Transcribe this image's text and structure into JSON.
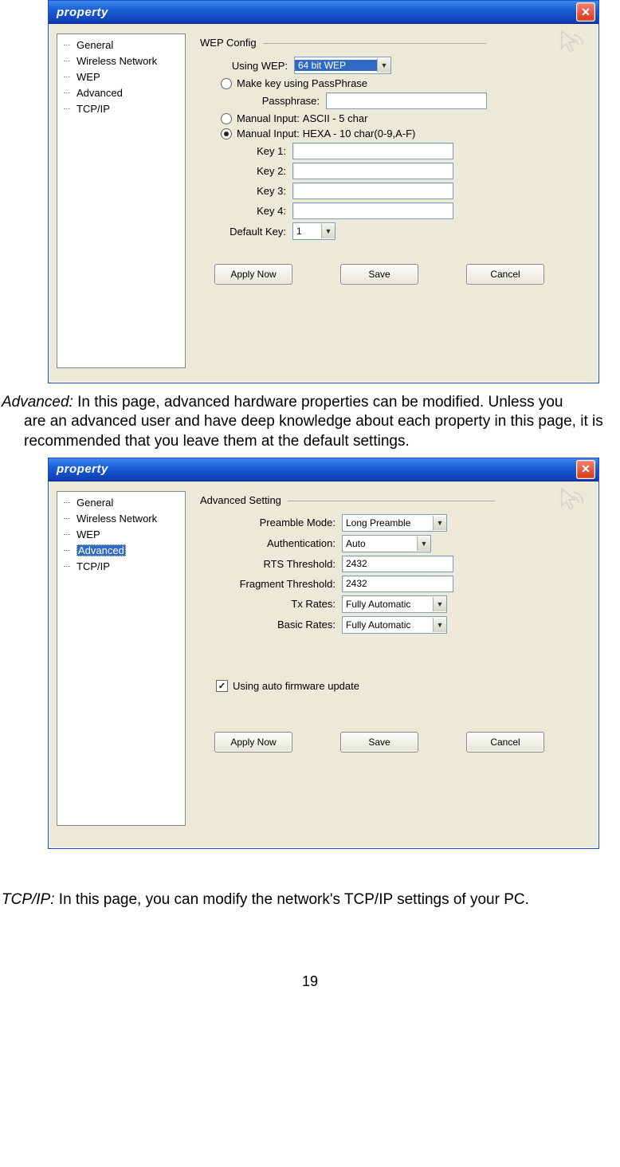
{
  "win1": {
    "title": "property",
    "tree": [
      "General",
      "Wireless Network",
      "WEP",
      "Advanced",
      "TCP/IP"
    ],
    "selected_index": -1,
    "section": "WEP Config",
    "using_wep_label": "Using WEP:",
    "using_wep_value": "64 bit WEP",
    "radio_passphrase": "Make key using PassPhrase",
    "passphrase_label": "Passphrase:",
    "radio_ascii": "Manual Input:",
    "ascii_suffix": "ASCII - 5 char",
    "radio_hexa": "Manual Input:",
    "hexa_suffix": "HEXA - 10 char(0-9,A-F)",
    "key1": "Key 1:",
    "key2": "Key 2:",
    "key3": "Key 3:",
    "key4": "Key 4:",
    "default_key_label": "Default Key:",
    "default_key_value": "1",
    "apply": "Apply Now",
    "save": "Save",
    "cancel": "Cancel"
  },
  "para1": {
    "term": "Advanced:",
    "lead": " In this page, advanced hardware properties can be modified. Unless you ",
    "rest": "are an advanced user and have deep knowledge about each property in this page, it is recommended that you leave them at the default settings."
  },
  "win2": {
    "title": "property",
    "tree": [
      "General",
      "Wireless Network",
      "WEP",
      "Advanced",
      "TCP/IP"
    ],
    "selected_index": 3,
    "section": "Advanced Setting",
    "preamble_label": "Preamble Mode:",
    "preamble_value": "Long Preamble",
    "auth_label": "Authentication:",
    "auth_value": "Auto",
    "rts_label": "RTS Threshold:",
    "rts_value": "2432",
    "frag_label": "Fragment Threshold:",
    "frag_value": "2432",
    "tx_label": "Tx Rates:",
    "tx_value": "Fully Automatic",
    "basic_label": "Basic Rates:",
    "basic_value": "Fully Automatic",
    "firmware_check": "✓",
    "firmware_label": "Using auto firmware update",
    "apply": "Apply Now",
    "save": "Save",
    "cancel": "Cancel"
  },
  "para2": {
    "term": "TCP/IP:",
    "text": " In this page, you can modify the network's TCP/IP settings of your PC."
  },
  "page_number": "19"
}
